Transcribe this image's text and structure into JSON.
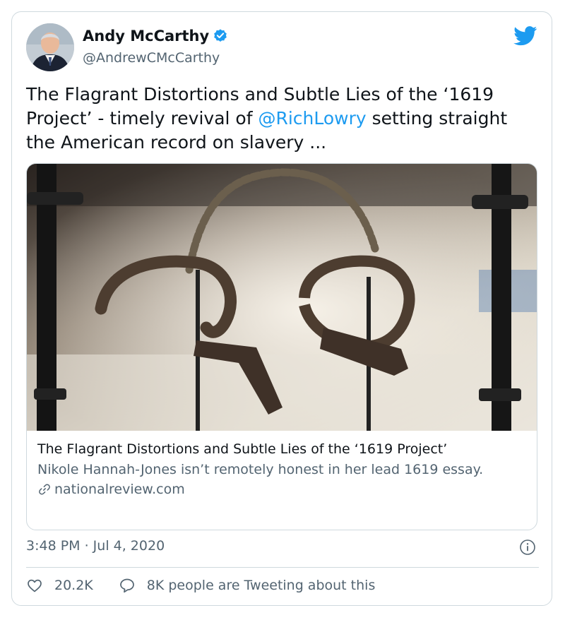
{
  "tweet": {
    "author_name": "Andy McCarthy",
    "author_handle": "@AndrewCMcCarthy",
    "text_before": "The Flagrant Distortions and Subtle Lies of the ‘1619 Project’ - timely revival of ",
    "mention": "@RichLowry",
    "text_after": " setting straight the American record on slavery ...",
    "timestamp": "3:48 PM · Jul 4, 2020",
    "likes": "20.2K",
    "tweeting_about": "8K people are Tweeting about this"
  },
  "link_card": {
    "title": "The Flagrant Distortions and Subtle Lies of the ‘1619 Project’",
    "description": "Nikole Hannah-Jones isn’t remotely honest in her lead 1619 essay.",
    "domain": "nationalreview.com"
  },
  "colors": {
    "accent": "#1d9bf0",
    "text_primary": "#0f1419",
    "text_secondary": "#536471",
    "border": "#cfd9de"
  },
  "icons": {
    "verified": "verified-badge-icon",
    "brand": "twitter-bird-icon",
    "info": "info-icon",
    "like": "heart-icon",
    "reply": "speech-bubble-icon",
    "link": "link-icon"
  }
}
